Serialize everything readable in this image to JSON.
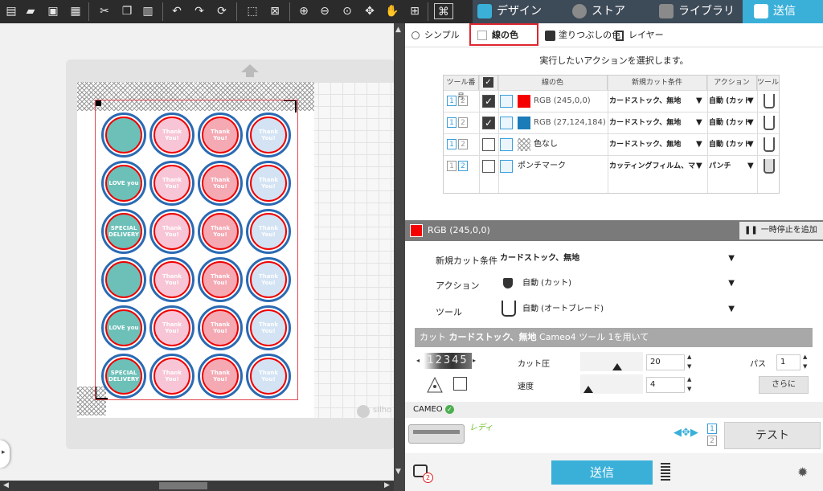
{
  "nav": {
    "design_label": "デザイン",
    "store_label": "ストア",
    "library_label": "ライブラリ",
    "send_tab_label": "送信"
  },
  "canvas": {
    "watermark": "silho",
    "stickers": [
      [
        "teal",
        "pink",
        "red",
        "light-blue"
      ],
      [
        "teal",
        "pink",
        "red",
        "light-blue"
      ],
      [
        "teal",
        "pink",
        "red",
        "light-blue"
      ],
      [
        "teal",
        "pink",
        "red",
        "light-blue"
      ],
      [
        "teal",
        "pink",
        "red",
        "light-blue"
      ],
      [
        "teal",
        "pink",
        "red",
        "light-blue"
      ]
    ],
    "sticker_colors": {
      "teal": "#6cc0b8",
      "pink": "#f7c5d5",
      "red": "#f4a9b3",
      "light-blue": "#d3e3f4"
    },
    "sticker_texts": [
      "",
      "LOVE you",
      "SPECIAL DELIVERY",
      "",
      "LOVE you",
      "SPECIAL DELIVERY"
    ],
    "thank_you_text": "Thank You!"
  },
  "mode_options": {
    "simple_label": "シンプル",
    "line_color_label": "線の色",
    "fill_color_label": "塗りつぶしの色",
    "layer_label": "レイヤー"
  },
  "instruction": "実行したいアクションを選択します。",
  "table": {
    "headers": [
      "ツール番号",
      "",
      "線の色",
      "新規カット条件",
      "アクション",
      "ツール"
    ],
    "rows": [
      {
        "checked": true,
        "color": "#f50000",
        "color_label": "RGB (245,0,0)",
        "material": "カードストック、無地",
        "action": "自動 (カット",
        "tool_nums": [
          "1",
          "2"
        ],
        "active_tool": "1"
      },
      {
        "checked": true,
        "color": "#1b7cb8",
        "color_label": "RGB (27,124,184)",
        "material": "カードストック、無地",
        "action": "自動 (カット",
        "tool_nums": [
          "1",
          "2"
        ],
        "active_tool": "1"
      },
      {
        "checked": false,
        "color": "none",
        "color_label": "色なし",
        "material": "カードストック、無地",
        "action": "自動 (カット",
        "tool_nums": [
          "1",
          "2"
        ],
        "active_tool": "1"
      },
      {
        "checked": false,
        "color": "none",
        "color_label": "ポンチマーク",
        "material": "カッティングフィルム、マット",
        "action": "パンチ",
        "tool_nums": [
          "1",
          "2"
        ],
        "active_tool": "2"
      }
    ]
  },
  "selected": {
    "color": "#f50000",
    "label": "RGB (245,0,0)",
    "pause_label": "一時停止を追加"
  },
  "settings": {
    "material_label": "新規カット条件",
    "material_value": "カードストック、無地",
    "action_label": "アクション",
    "action_value": "自動 (カット)",
    "tool_label": "ツール",
    "tool_value": "自動 (オートブレード)",
    "cut_title_prefix": "カット",
    "cut_title_material": "カードストック、無地",
    "cut_title_suffix": "Cameo4 ツール 1を用いて",
    "blade_digits": "12345",
    "force_label": "カット圧",
    "force_value": "20",
    "speed_label": "速度",
    "speed_value": "4",
    "passes_label": "パス",
    "passes_value": "1",
    "more_label": "さらに"
  },
  "device": {
    "name": "CAMEO",
    "status": "レディ",
    "test_label": "テスト",
    "tool_slots": [
      "1",
      "2"
    ]
  },
  "send_button_label": "送信",
  "notification_count": "2"
}
